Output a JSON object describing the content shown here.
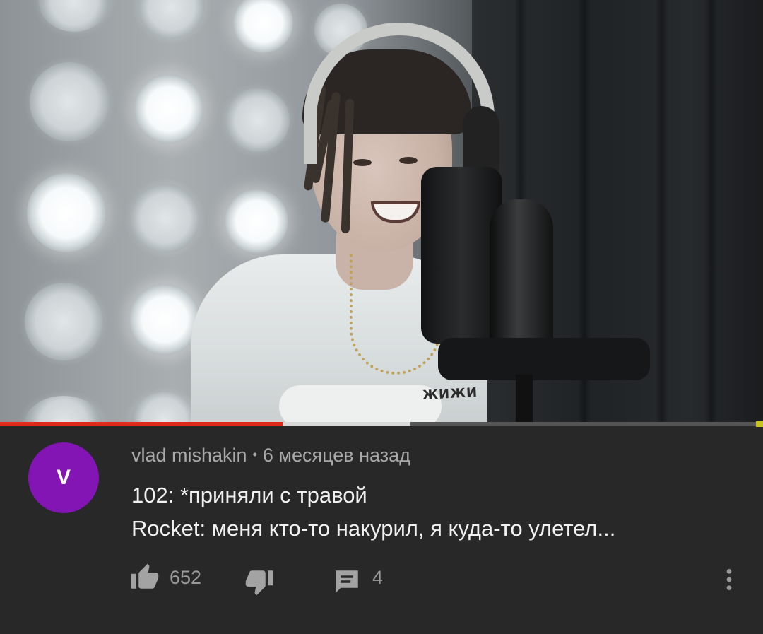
{
  "video": {
    "shirt_print": "ЖИЖИ",
    "progress": {
      "played_fraction": 0.37,
      "buffered_fraction": 0.538
    }
  },
  "comment": {
    "avatar_letter": "V",
    "avatar_color": "#8215b3",
    "author": "vlad mishakin",
    "separator": "•",
    "timestamp": "6 месяцев назад",
    "lines": [
      "102: *приняли с травой",
      "Rocket: меня кто-то накурил, я куда-то улетел..."
    ],
    "likes": "652",
    "replies": "4"
  },
  "icons": {
    "like": "thumbs-up-icon",
    "dislike": "thumbs-down-icon",
    "reply": "comment-icon",
    "more": "more-vertical-icon"
  },
  "colors": {
    "background": "#282828",
    "progress_played": "#e52720",
    "progress_buffered": "#d8d8d8",
    "meta_text": "#a9a9a9",
    "body_text": "#f1f1f1"
  }
}
